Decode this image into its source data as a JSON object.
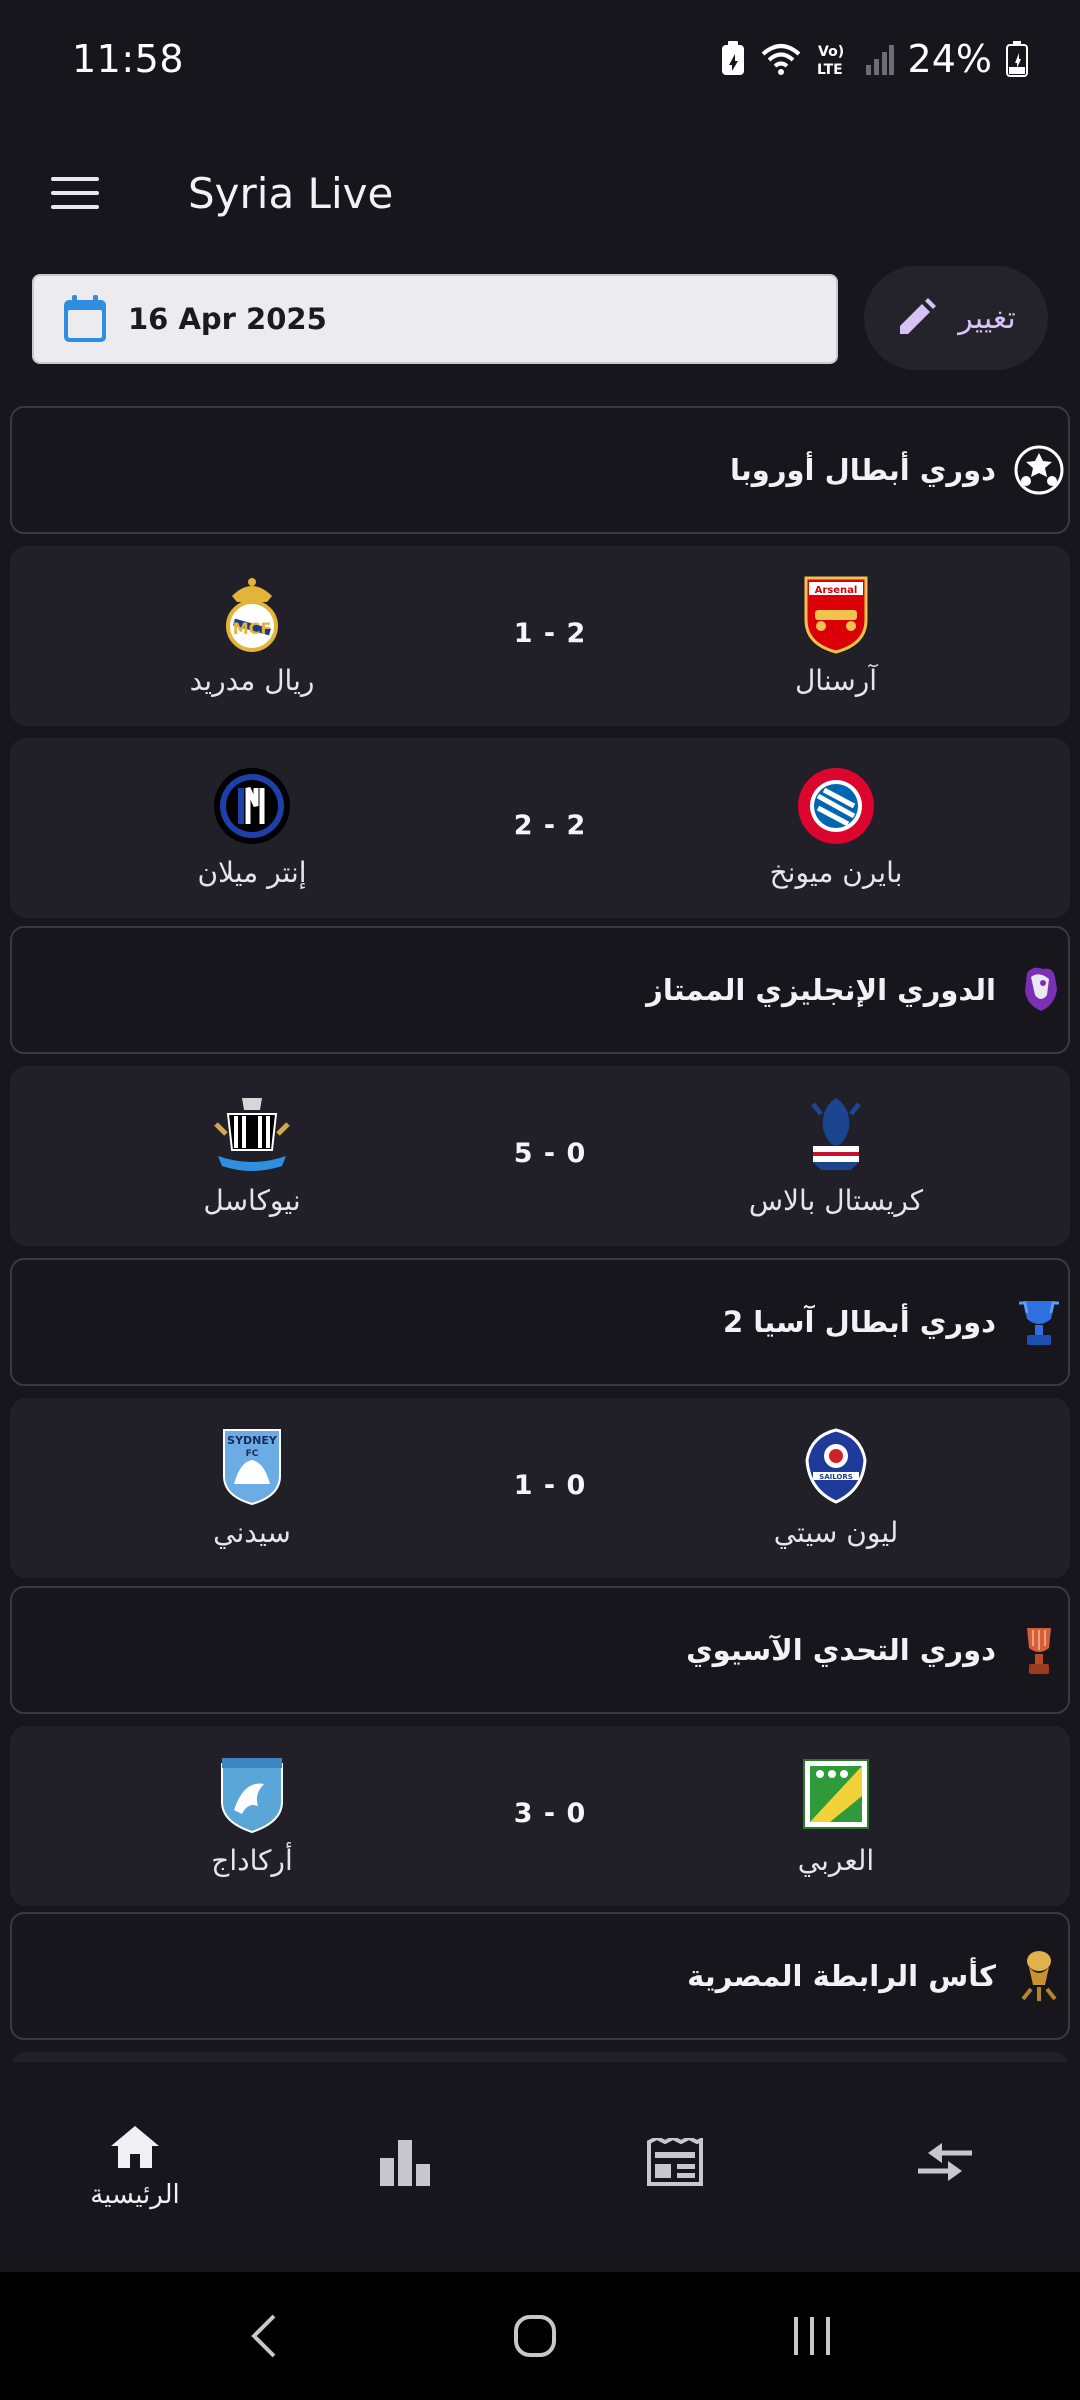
{
  "status_bar": {
    "time": "11:58",
    "battery_percent": "24%",
    "network_label": "Vo) LTE",
    "icons": [
      "battery-saver-icon",
      "wifi-icon",
      "volte-icon",
      "signal-icon",
      "battery-charging-icon"
    ]
  },
  "app_bar": {
    "title": "Syria Live",
    "menu_icon": "hamburger-menu-icon"
  },
  "date_picker": {
    "date": "16 Apr 2025",
    "change_label": "تغيير",
    "calendar_icon": "calendar-icon",
    "edit_icon": "pencil-icon"
  },
  "leagues": [
    {
      "name": "دوري أبطال أوروبا",
      "icon": "champions-league-icon",
      "matches": [
        {
          "home": "آرسنال",
          "away": "ريال مدريد",
          "score": "1 - 2"
        },
        {
          "home": "بايرن ميونخ",
          "away": "إنتر ميلان",
          "score": "2 - 2"
        }
      ]
    },
    {
      "name": "الدوري الإنجليزي الممتاز",
      "icon": "premier-league-icon",
      "matches": [
        {
          "home": "كريستال بالاس",
          "away": "نيوكاسل",
          "score": "5 - 0"
        }
      ]
    },
    {
      "name": "دوري أبطال آسيا 2",
      "icon": "afc-trophy-icon",
      "matches": [
        {
          "home": "ليون سيتي",
          "away": "سيدني",
          "score": "1 - 0"
        }
      ]
    },
    {
      "name": "دوري التحدي الآسيوي",
      "icon": "challenge-trophy-icon",
      "matches": [
        {
          "home": "العربي",
          "away": "أركاداج",
          "score": "3 - 0"
        }
      ]
    },
    {
      "name": "كأس الرابطة المصرية",
      "icon": "league-cup-trophy-icon",
      "matches": []
    }
  ],
  "bottom_nav": [
    {
      "label": "الرئيسية",
      "icon": "home-icon",
      "active": true
    },
    {
      "label": "",
      "icon": "bar-chart-icon",
      "active": false
    },
    {
      "label": "",
      "icon": "news-icon",
      "active": false
    },
    {
      "label": "",
      "icon": "transfer-arrows-icon",
      "active": false
    }
  ],
  "colors": {
    "background": "#17161c",
    "card": "#211f27",
    "accent_blue": "#2f8ee0",
    "accent_purple": "#d6c2f5"
  }
}
